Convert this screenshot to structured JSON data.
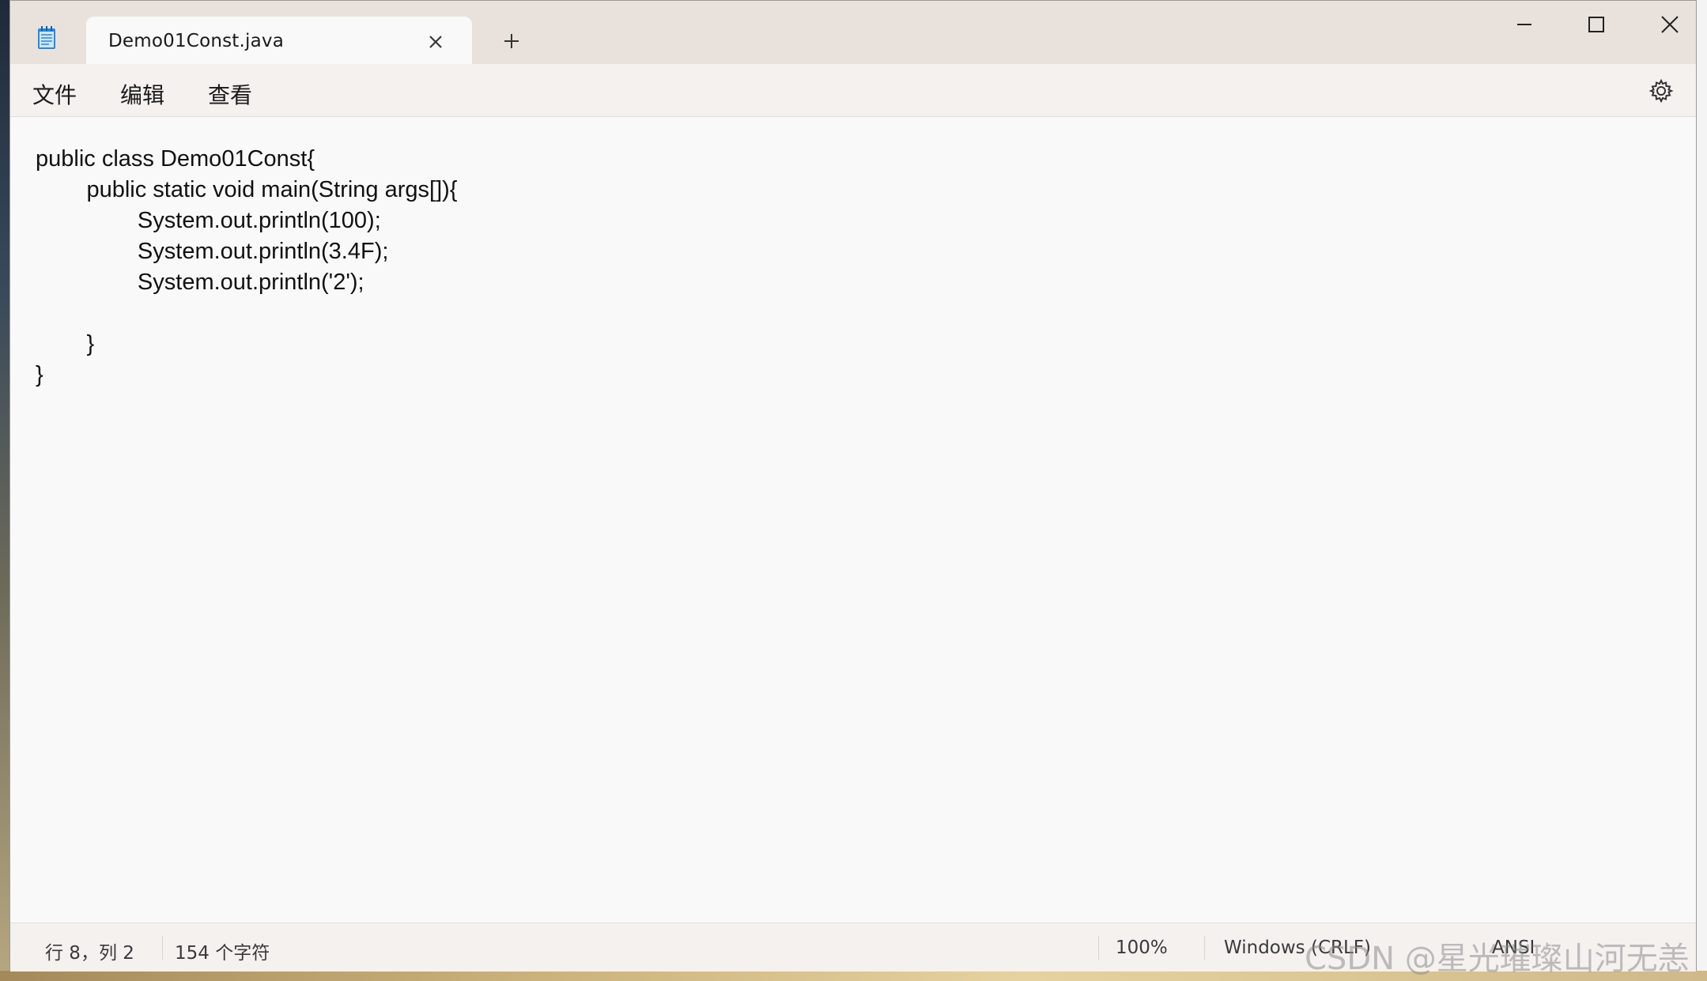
{
  "window": {
    "tab_title": "Demo01Const.java",
    "new_tab_symbol": "+",
    "app_icon": "notepad-icon"
  },
  "menu": {
    "items": [
      "文件",
      "编辑",
      "查看"
    ],
    "settings_icon": "gear-icon"
  },
  "editor": {
    "lines": [
      "public class Demo01Const{",
      "        public static void main(String args[]){",
      "                System.out.println(100);",
      "                System.out.println(3.4F);",
      "                System.out.println('2');",
      "",
      "        }",
      "}"
    ]
  },
  "status": {
    "position": "行 8，列 2",
    "char_count": "154 个字符",
    "zoom": "100%",
    "line_ending": "Windows (CRLF)",
    "encoding": "ANSI"
  },
  "watermark": "CSDN @星光璀璨山河无恙",
  "colors": {
    "titlebar": "#e9e2dc",
    "editor_bg": "#f9f9f9",
    "accent_icon": "#2b88d8"
  }
}
